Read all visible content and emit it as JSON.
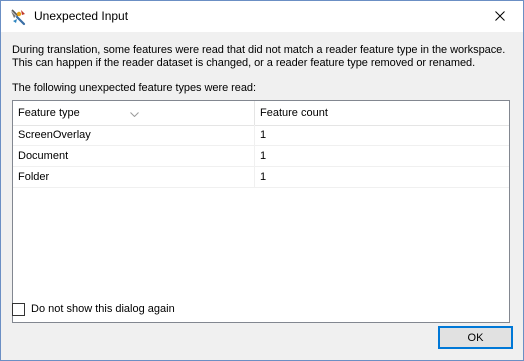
{
  "window": {
    "title": "Unexpected Input",
    "close_glyph": "✕"
  },
  "message": {
    "line1": "During translation, some features were read that did not match a reader feature type in the workspace.",
    "line2": "This can happen if the reader dataset is changed, or a reader feature type removed or renamed.",
    "line3": "The following unexpected feature types were read:"
  },
  "table": {
    "columns": [
      "Feature type",
      "Feature count"
    ],
    "rows": [
      {
        "type": "ScreenOverlay",
        "count": "1"
      },
      {
        "type": "Document",
        "count": "1"
      },
      {
        "type": "Folder",
        "count": "1"
      }
    ]
  },
  "checkbox": {
    "label": "Do not show this dialog again",
    "checked": false
  },
  "buttons": {
    "ok_label": "OK"
  },
  "icons": {
    "app": "fme-workbench-icon",
    "close": "close-icon",
    "sort": "sort-indicator-icon"
  },
  "colors": {
    "window_border": "#6b8fc4",
    "button_focus": "#0078d7",
    "dialog_bg": "#f0f0f0"
  }
}
